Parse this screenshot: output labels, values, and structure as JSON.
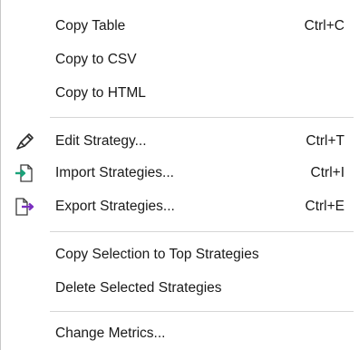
{
  "menu": {
    "items": [
      {
        "label": "Copy Table",
        "shortcut": "Ctrl+C",
        "icon": ""
      },
      {
        "label": "Copy to CSV",
        "shortcut": "",
        "icon": ""
      },
      {
        "label": "Copy to HTML",
        "shortcut": "",
        "icon": ""
      },
      {
        "label": "Edit Strategy...",
        "shortcut": "Ctrl+T",
        "icon": "pen-icon"
      },
      {
        "label": "Import Strategies...",
        "shortcut": "Ctrl+I",
        "icon": "import-icon"
      },
      {
        "label": "Export Strategies...",
        "shortcut": "Ctrl+E",
        "icon": "export-icon"
      },
      {
        "label": "Copy Selection to Top Strategies",
        "shortcut": "",
        "icon": ""
      },
      {
        "label": "Delete Selected Strategies",
        "shortcut": "",
        "icon": ""
      },
      {
        "label": "Change Metrics...",
        "shortcut": "",
        "icon": ""
      }
    ]
  },
  "colors": {
    "import_arrow": "#1aa37a",
    "export_arrow": "#7a2fbf",
    "separator": "#d6d6d6"
  }
}
